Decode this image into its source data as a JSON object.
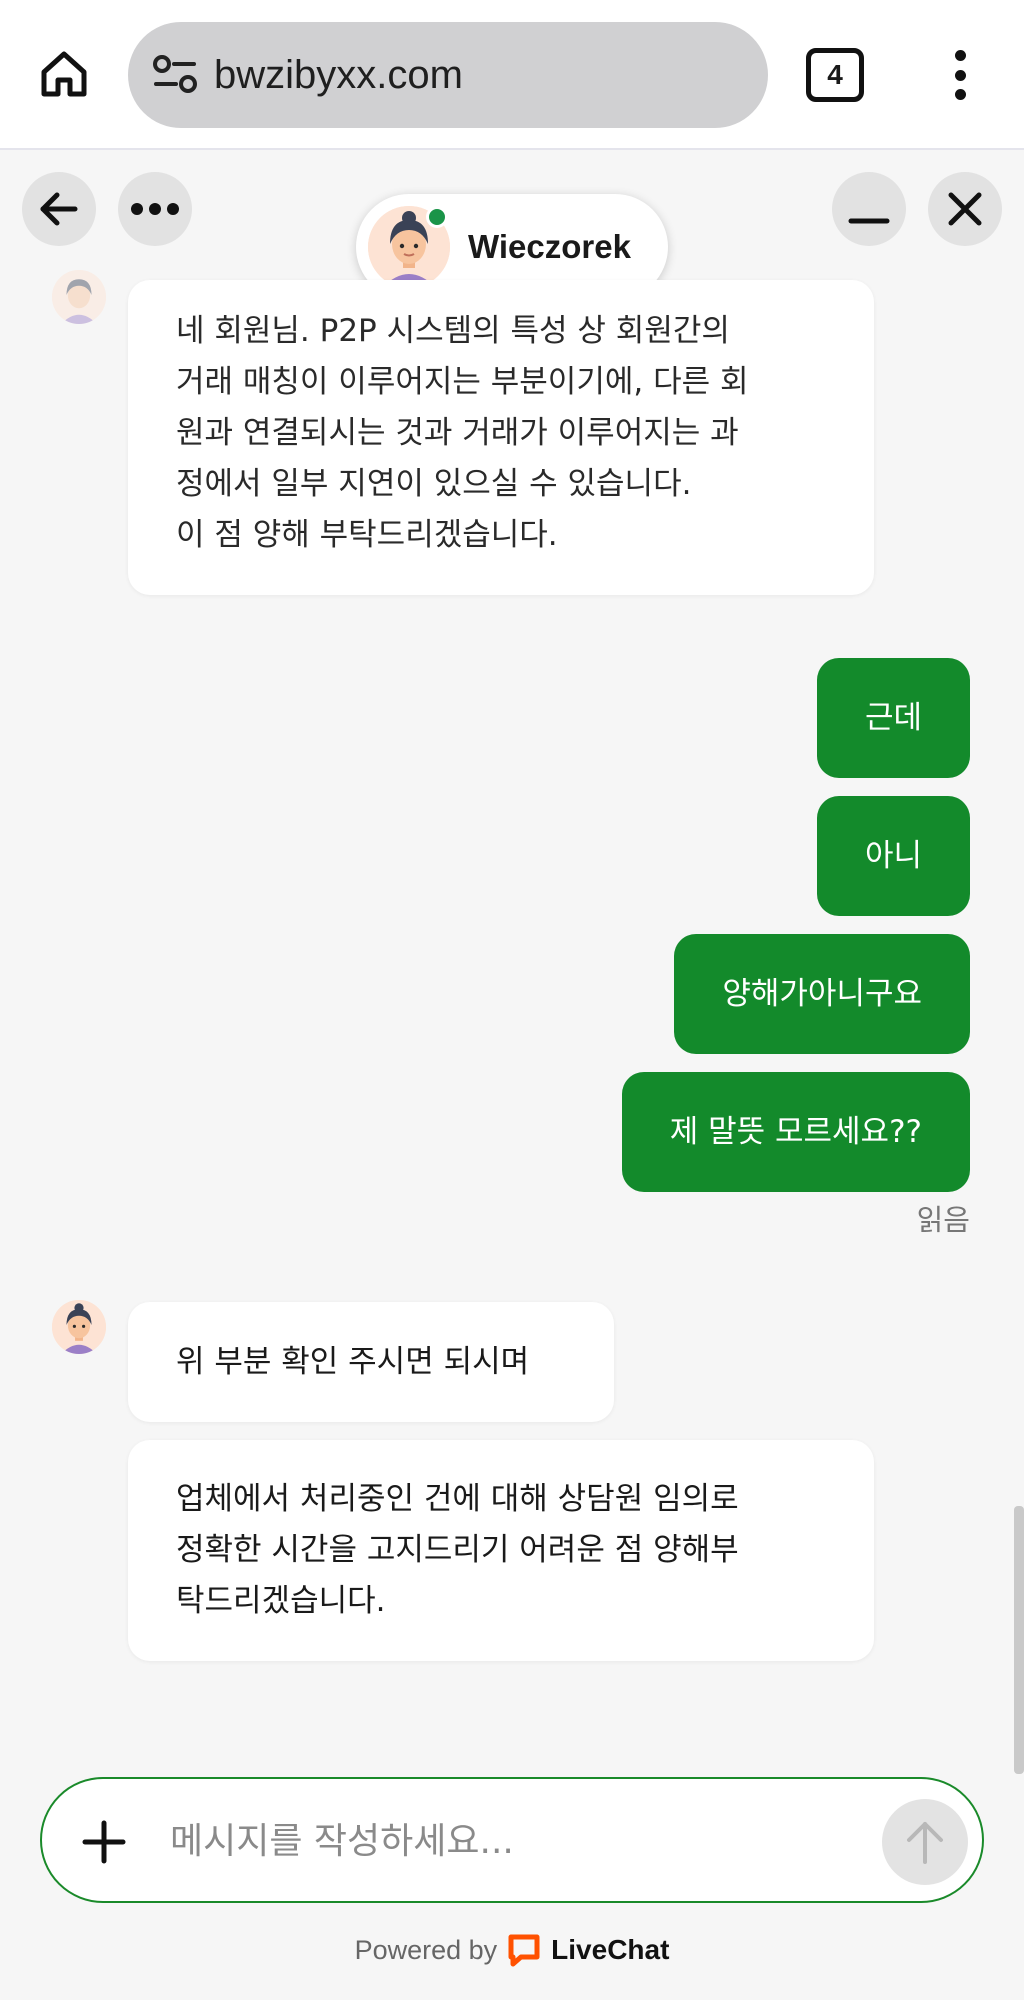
{
  "browser": {
    "url": "bwzibyxx.com",
    "tab_count": "4"
  },
  "chat_header": {
    "agent_name": "Wieczorek"
  },
  "messages": {
    "agent_1": "네 회원님. P2P 시스템의 특성 상 회원간의\n거래 매칭이 이루어지는 부분이기에, 다른 회\n원과 연결되시는 것과 거래가 이루어지는 과\n정에서 일부 지연이 있으실 수 있습니다.\n이 점 양해 부탁드리겠습니다.",
    "user_1": "근데",
    "user_2": "아니",
    "user_3": "양해가아니구요",
    "user_4": "제 말뜻 모르세요??",
    "read_status": "읽음",
    "agent_2": "위 부분 확인 주시면 되시며",
    "agent_3": "업체에서 처리중인 건에 대해 상담원 임의로\n정확한 시간을 고지드리기 어려운 점 양해부\n탁드리겠습니다."
  },
  "composer": {
    "placeholder": "메시지를 작성하세요..."
  },
  "footer": {
    "powered_by": "Powered by",
    "brand": "LiveChat"
  },
  "colors": {
    "user_bubble": "#138a2b",
    "online_dot": "#1a9448",
    "livechat_orange": "#ff5100"
  }
}
